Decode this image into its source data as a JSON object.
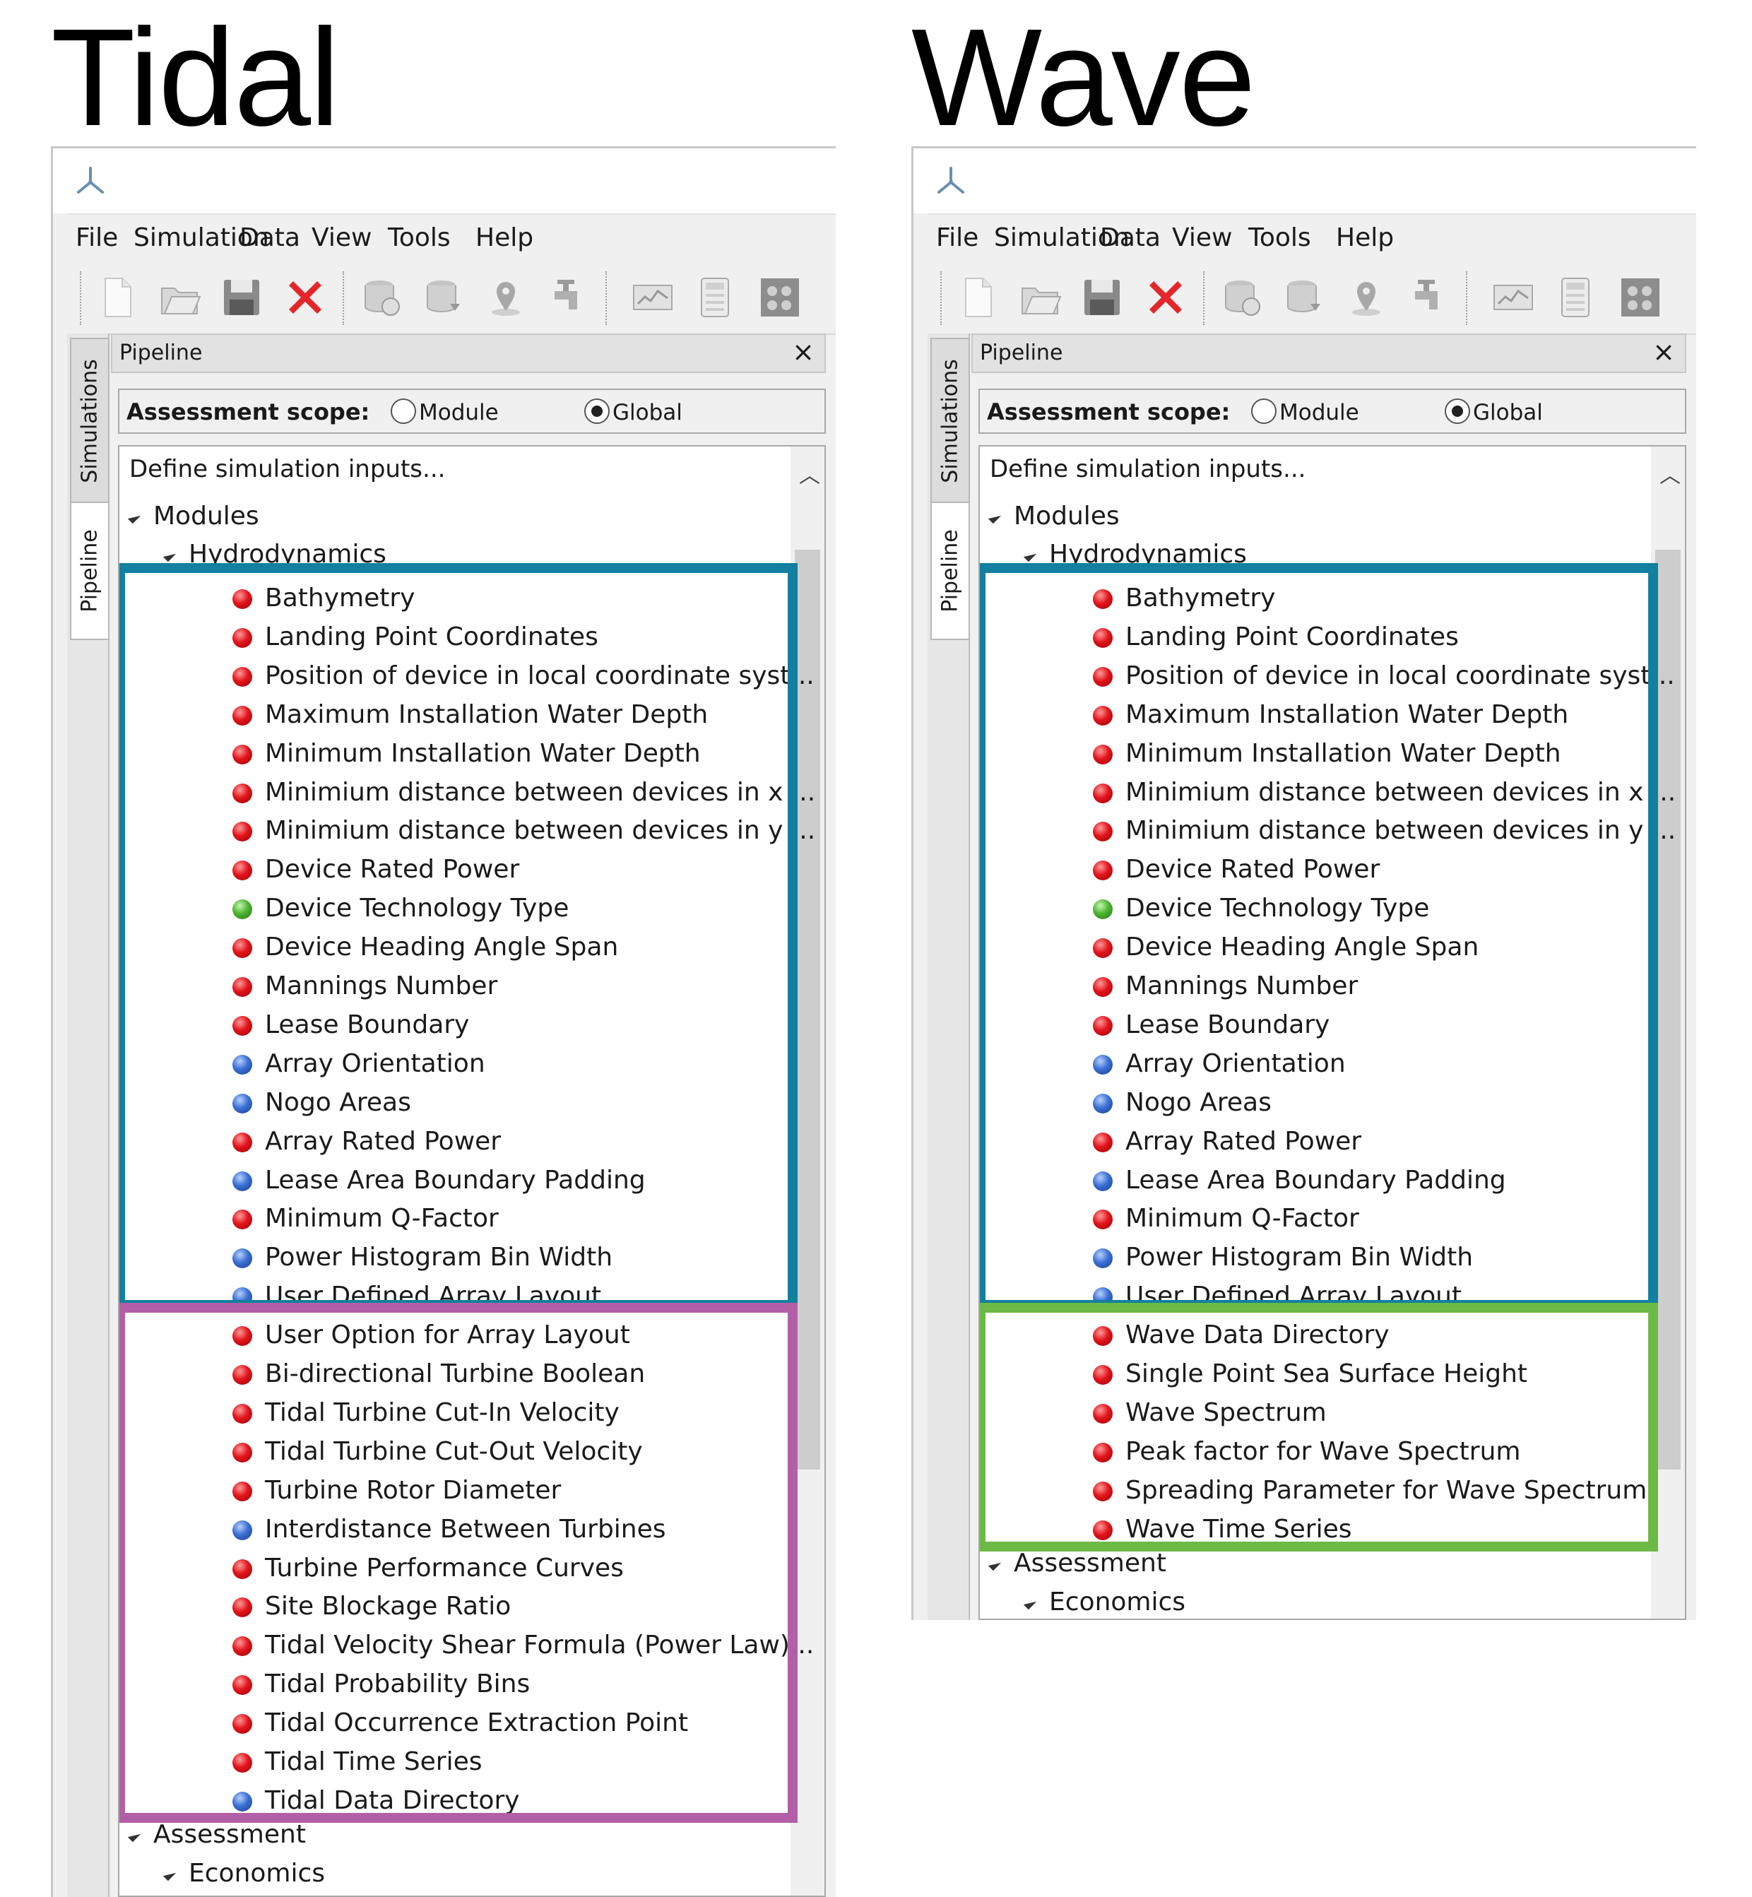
{
  "tidal": {
    "heading": "Tidal",
    "menu": [
      "File",
      "Simulation",
      "Data",
      "View",
      "Tools",
      "Help"
    ],
    "side_tabs": [
      "Simulations",
      "Pipeline"
    ],
    "panel_title": "Pipeline",
    "close_label": "×",
    "scope_label": "Assessment scope:",
    "scope_options": [
      {
        "label": "Module",
        "selected": false
      },
      {
        "label": "Global",
        "selected": true
      }
    ],
    "tree_header": "Define simulation inputs...",
    "modules_label": "Modules",
    "hydro_label": "Hydrodynamics",
    "items": [
      {
        "label": "Bathymetry",
        "status": "red"
      },
      {
        "label": "Landing Point Coordinates",
        "status": "red"
      },
      {
        "label": "Position of device in local coordinate syst...",
        "status": "red"
      },
      {
        "label": "Maximum Installation Water Depth",
        "status": "red"
      },
      {
        "label": "Minimum Installation Water Depth",
        "status": "red"
      },
      {
        "label": "Minimium distance between devices in x ...",
        "status": "red"
      },
      {
        "label": "Minimium distance between devices in y ...",
        "status": "red"
      },
      {
        "label": "Device Rated Power",
        "status": "red"
      },
      {
        "label": "Device Technology Type",
        "status": "green"
      },
      {
        "label": "Device Heading Angle Span",
        "status": "red"
      },
      {
        "label": "Mannings Number",
        "status": "red"
      },
      {
        "label": "Lease Boundary",
        "status": "red"
      },
      {
        "label": "Array Orientation",
        "status": "blue"
      },
      {
        "label": "Nogo Areas",
        "status": "blue"
      },
      {
        "label": "Array Rated Power",
        "status": "red"
      },
      {
        "label": "Lease Area Boundary Padding",
        "status": "blue"
      },
      {
        "label": "Minimum Q-Factor",
        "status": "red"
      },
      {
        "label": "Power Histogram Bin Width",
        "status": "blue"
      },
      {
        "label": "User Defined Array Layout",
        "status": "blue"
      },
      {
        "label": "User Option for Array Layout",
        "status": "red"
      },
      {
        "label": "Bi-directional Turbine Boolean",
        "status": "red"
      },
      {
        "label": "Tidal Turbine Cut-In Velocity",
        "status": "red"
      },
      {
        "label": "Tidal Turbine Cut-Out Velocity",
        "status": "red"
      },
      {
        "label": "Turbine Rotor Diameter",
        "status": "red"
      },
      {
        "label": "Interdistance Between Turbines",
        "status": "blue"
      },
      {
        "label": "Turbine Performance Curves",
        "status": "red"
      },
      {
        "label": "Site Blockage Ratio",
        "status": "red"
      },
      {
        "label": "Tidal Velocity Shear Formula (Power Law)...",
        "status": "red"
      },
      {
        "label": "Tidal Probability Bins",
        "status": "red"
      },
      {
        "label": "Tidal Occurrence Extraction Point",
        "status": "red"
      },
      {
        "label": "Tidal Time Series",
        "status": "red"
      },
      {
        "label": "Tidal Data Directory",
        "status": "blue"
      }
    ],
    "assessment_label": "Assessment",
    "economics_label": "Economics",
    "highlight_common_color": "#12809e",
    "highlight_specific_color": "#b35fa8"
  },
  "wave": {
    "heading": "Wave",
    "menu": [
      "File",
      "Simulation",
      "Data",
      "View",
      "Tools",
      "Help"
    ],
    "side_tabs": [
      "Simulations",
      "Pipeline"
    ],
    "panel_title": "Pipeline",
    "close_label": "×",
    "scope_label": "Assessment scope:",
    "scope_options": [
      {
        "label": "Module",
        "selected": false
      },
      {
        "label": "Global",
        "selected": true
      }
    ],
    "tree_header": "Define simulation inputs...",
    "modules_label": "Modules",
    "hydro_label": "Hydrodynamics",
    "items": [
      {
        "label": "Bathymetry",
        "status": "red"
      },
      {
        "label": "Landing Point Coordinates",
        "status": "red"
      },
      {
        "label": "Position of device in local coordinate syst...",
        "status": "red"
      },
      {
        "label": "Maximum Installation Water Depth",
        "status": "red"
      },
      {
        "label": "Minimum Installation Water Depth",
        "status": "red"
      },
      {
        "label": "Minimium distance between devices in x ...",
        "status": "red"
      },
      {
        "label": "Minimium distance between devices in y ...",
        "status": "red"
      },
      {
        "label": "Device Rated Power",
        "status": "red"
      },
      {
        "label": "Device Technology Type",
        "status": "green"
      },
      {
        "label": "Device Heading Angle Span",
        "status": "red"
      },
      {
        "label": "Mannings Number",
        "status": "red"
      },
      {
        "label": "Lease Boundary",
        "status": "red"
      },
      {
        "label": "Array Orientation",
        "status": "blue"
      },
      {
        "label": "Nogo Areas",
        "status": "blue"
      },
      {
        "label": "Array Rated Power",
        "status": "red"
      },
      {
        "label": "Lease Area Boundary Padding",
        "status": "blue"
      },
      {
        "label": "Minimum Q-Factor",
        "status": "red"
      },
      {
        "label": "Power Histogram Bin Width",
        "status": "blue"
      },
      {
        "label": "User Defined Array Layout",
        "status": "blue"
      },
      {
        "label": "Wave Data Directory",
        "status": "red"
      },
      {
        "label": "Single Point Sea Surface Height",
        "status": "red"
      },
      {
        "label": "Wave Spectrum",
        "status": "red"
      },
      {
        "label": "Peak factor for Wave Spectrum",
        "status": "red"
      },
      {
        "label": "Spreading Parameter for Wave Spectrum",
        "status": "red"
      },
      {
        "label": "Wave Time Series",
        "status": "red"
      }
    ],
    "assessment_label": "Assessment",
    "economics_label": "Economics",
    "highlight_common_color": "#12809e",
    "highlight_specific_color": "#6cba45"
  }
}
